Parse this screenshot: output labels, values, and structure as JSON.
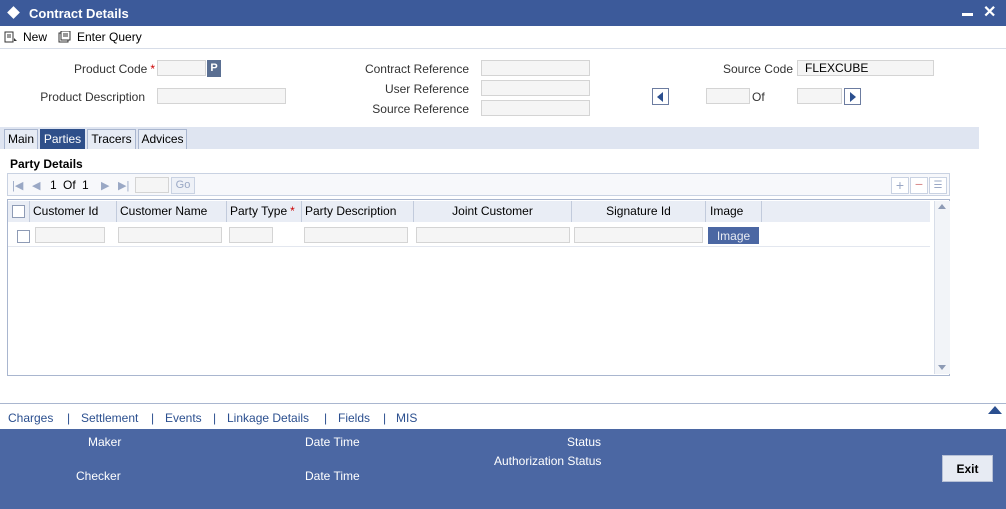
{
  "window": {
    "title": "Contract Details"
  },
  "toolbar": {
    "new_label": "New",
    "enter_query_label": "Enter Query"
  },
  "header": {
    "product_code_label": "Product Code",
    "required_mark": "*",
    "product_code_value": "",
    "p_button_label": "P",
    "product_description_label": "Product Description",
    "contract_reference_label": "Contract Reference",
    "user_reference_label": "User Reference",
    "source_reference_label": "Source Reference",
    "source_code_label": "Source Code",
    "source_code_value": "FLEXCUBE",
    "of_label": "Of"
  },
  "tabs": [
    {
      "label": "Main"
    },
    {
      "label": "Parties"
    },
    {
      "label": "Tracers"
    },
    {
      "label": "Advices"
    }
  ],
  "active_tab": "Parties",
  "party_details": {
    "title": "Party Details",
    "pager": {
      "current": "1",
      "of_label": "Of",
      "total": "1",
      "go_label": "Go"
    },
    "columns": [
      "Customer Id",
      "Customer Name",
      "Party Type",
      "Party Description",
      "Joint Customer",
      "Signature Id",
      "Image"
    ],
    "party_type_required": "*",
    "row_image_button_label": "Image"
  },
  "links": [
    "Charges",
    "Settlement",
    "Events",
    "Linkage Details",
    "Fields",
    "MIS"
  ],
  "link_separator": "|",
  "footer": {
    "maker_label": "Maker",
    "checker_label": "Checker",
    "date_time_label": "Date Time",
    "status_label": "Status",
    "authorization_status_label": "Authorization Status",
    "exit_label": "Exit"
  },
  "colors": {
    "titlebar": "#3c5a9a",
    "active_tab": "#2e4f8a",
    "footer": "#4b67a3",
    "link": "#2b4f8f"
  },
  "icons": [
    "diamond-icon",
    "minimize-icon",
    "close-icon",
    "new-icon",
    "enter-query-icon",
    "first-page-icon",
    "prev-page-icon",
    "next-page-icon",
    "last-page-icon",
    "add-row-icon",
    "delete-row-icon",
    "single-view-icon",
    "scroll-up-icon",
    "scroll-down-icon",
    "collapse-up-icon"
  ]
}
